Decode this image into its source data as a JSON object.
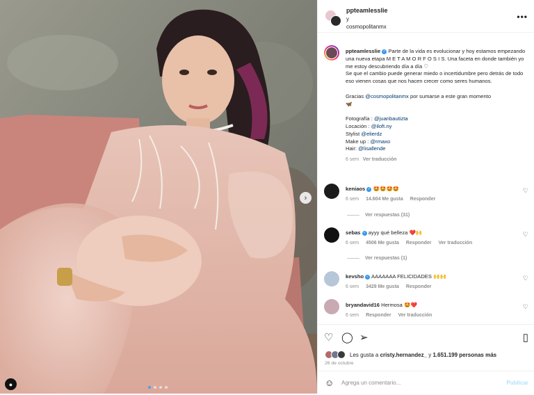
{
  "post": {
    "carousel": {
      "next_icon": "chevron-right-icon",
      "slide_count": 4,
      "active_slide": 1,
      "tag_icon": "person-tag-icon"
    }
  },
  "header": {
    "user1": "ppteamlesslie",
    "connector": "y",
    "user2": "cosmopolitanmx",
    "more_icon": "more-horizontal-icon",
    "more_label": "•••"
  },
  "caption": {
    "username": "ppteamlesslie",
    "text1": " Parte de la vida es evolucionar y hoy estamos empezando una nueva etapa ",
    "metamorfosis": "M E T A M O R F O S I S",
    "text2": ". Una faceta en donde también yo me estoy descubriendo día a día ♡",
    "text3": "Se que el cambio puede generar miedo o incertidumbre pero detrás de todo eso vienen cosas que nos hacen crecer como seres humanos.",
    "thanks_pre": "Gracias ",
    "thanks_tag": "@cosmopolitanmx",
    "thanks_post": " por sumarse a este gran momento",
    "butterfly": "🦋",
    "credits": [
      {
        "label": "Fotografía : ",
        "tag": "@juanbautizta"
      },
      {
        "label": "Locación : ",
        "tag": "@iloft.ny"
      },
      {
        "label": "Stylist ",
        "tag": "@elierdz"
      },
      {
        "label": "Make up : ",
        "tag": "@rmaxo"
      },
      {
        "label": "Hair: ",
        "tag": "@lisallende"
      }
    ],
    "time": "6 sem",
    "translate": "Ver traducción"
  },
  "comments": [
    {
      "user": "keniaos",
      "verified": true,
      "text": "🤩🤩🤩🤩",
      "time": "6 sem",
      "likes": "14.604 Me gusta",
      "reply": "Responder",
      "translate": "",
      "replies": "Ver respuestas (31)"
    },
    {
      "user": "sebas",
      "verified": true,
      "text": "ayyy qué belleza ❤️🙌",
      "time": "6 sem",
      "likes": "4506 Me gusta",
      "reply": "Responder",
      "translate": "Ver traducción",
      "replies": "Ver respuestas (1)"
    },
    {
      "user": "kevsho",
      "verified": true,
      "text": "AAAAAAA FELICIDADES 🙌🙌",
      "time": "6 sem",
      "likes": "3429 Me gusta",
      "reply": "Responder",
      "translate": "",
      "replies": ""
    },
    {
      "user": "bryandavid16",
      "verified": false,
      "text": "Hermosa 🤩❤️",
      "time": "6 sem",
      "likes": "",
      "reply": "Responder",
      "translate": "Ver traducción",
      "replies": ""
    }
  ],
  "actions": {
    "like_icon": "heart-icon",
    "comment_icon": "comment-icon",
    "share_icon": "send-icon",
    "save_icon": "bookmark-icon",
    "likes_pre": "Les gusta a ",
    "likes_user": "cristy.hernandez_",
    "likes_mid": " y ",
    "likes_count": "1.651.199 personas más",
    "date": "26 de octubre"
  },
  "comment_box": {
    "emoji_icon": "emoji-smile-icon",
    "placeholder": "Agrega un comentario...",
    "publish": "Publicar"
  }
}
